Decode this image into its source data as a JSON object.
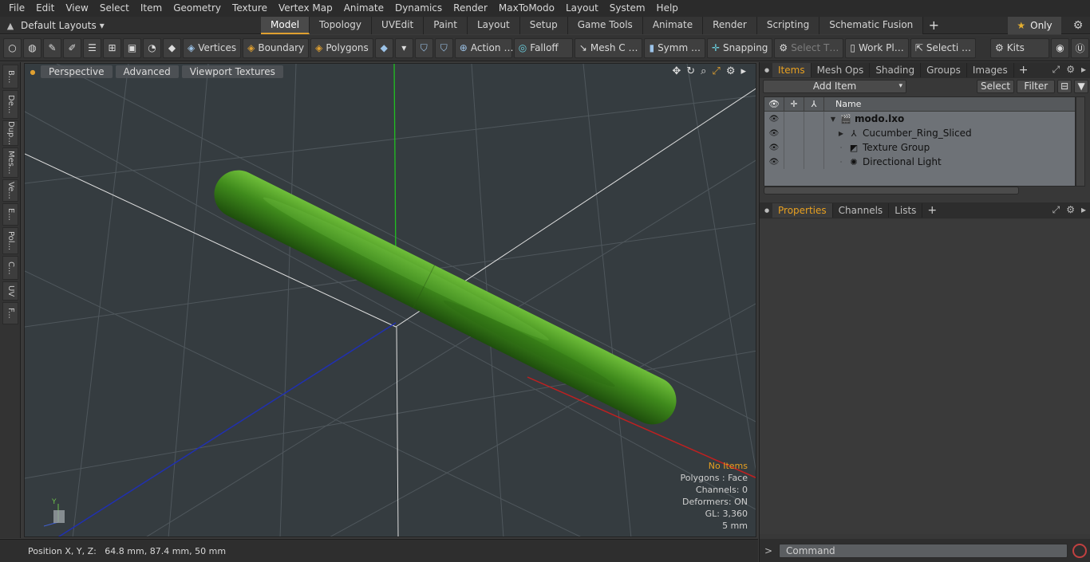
{
  "menu": [
    "File",
    "Edit",
    "View",
    "Select",
    "Item",
    "Geometry",
    "Texture",
    "Vertex Map",
    "Animate",
    "Dynamics",
    "Render",
    "MaxToModo",
    "Layout",
    "System",
    "Help"
  ],
  "layout_selector": {
    "label": "Default Layouts",
    "arrow": "▾",
    "up_icon": "▲"
  },
  "tabs": [
    "Model",
    "Topology",
    "UVEdit",
    "Paint",
    "Layout",
    "Setup",
    "Game Tools",
    "Animate",
    "Render",
    "Scripting",
    "Schematic Fusion"
  ],
  "tab_add": "+",
  "only": {
    "star": "★",
    "label": "Only"
  },
  "gear": "⚙",
  "toolbar": {
    "vertices": "Vertices",
    "boundary": "Boundary",
    "polygons": "Polygons",
    "action": "Action",
    "action_more": "…",
    "falloff": "Falloff",
    "mesh": "Mesh C …",
    "symm": "Symm …",
    "snapping": "Snapping",
    "select_t": "Select T…",
    "work_pl": "Work Pl…",
    "selecti": "Selecti …",
    "kits": "Kits"
  },
  "left_tabs": [
    "B...",
    "De...",
    "Dup...",
    "Mes...",
    "Ve...",
    "E...",
    "Pol...",
    "C...",
    "UV",
    "F..."
  ],
  "viewport": {
    "buttons": [
      "Perspective",
      "Advanced",
      "Viewport Textures"
    ],
    "tools": [
      "✥",
      "↻",
      "⌕",
      "⤢",
      "⚙",
      "▸"
    ],
    "info": {
      "no_items": "No Items",
      "polygons": "Polygons : Face",
      "channels": "Channels: 0",
      "deformers": "Deformers: ON",
      "gl": "GL: 3,360",
      "scale": "5 mm"
    },
    "axis_y": "Y"
  },
  "status": {
    "position": "Position X, Y, Z:   64.8 mm, 87.4 mm, 50 mm"
  },
  "items_panel": {
    "tabs": [
      "Items",
      "Mesh Ops",
      "Shading",
      "Groups",
      "Images"
    ],
    "add_item": "Add Item",
    "select": "Select",
    "filter": "Filter",
    "col_name": "Name",
    "rows": [
      {
        "name": "modo.lxo",
        "icon": "🎬",
        "indent": 0,
        "expander": "▼"
      },
      {
        "name": "Cucumber_Ring_Sliced",
        "icon": "⅄",
        "indent": 1,
        "expander": "▶"
      },
      {
        "name": "Texture Group",
        "icon": "◩",
        "indent": 1,
        "expander": "·"
      },
      {
        "name": "Directional Light",
        "icon": "✺",
        "indent": 1,
        "expander": "·"
      }
    ]
  },
  "props_panel": {
    "tabs": [
      "Properties",
      "Channels",
      "Lists"
    ]
  },
  "command": {
    "prompt": ">",
    "placeholder": "Command"
  },
  "colors": {
    "accent": "#e8a020",
    "viewport_bg": "#353c40",
    "cucumber": "#3f8a1c",
    "x_axis": "#c02020",
    "y_axis": "#20c020",
    "z_axis": "#2030b0"
  }
}
